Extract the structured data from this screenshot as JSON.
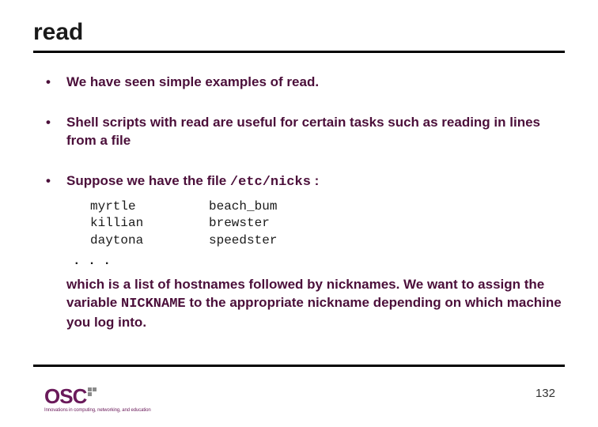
{
  "title": "read",
  "bullets": [
    {
      "text": "We have seen simple examples of read."
    },
    {
      "text": "Shell scripts with read are useful for certain tasks such as reading in lines from a file"
    }
  ],
  "bullet3": {
    "prefix": "Suppose we have the file ",
    "file": "/etc/nicks",
    "suffix": " :",
    "rows": [
      {
        "c1": "myrtle",
        "c2": "beach_bum"
      },
      {
        "c1": "killian",
        "c2": "brewster"
      },
      {
        "c1": "daytona",
        "c2": "speedster"
      }
    ],
    "ellipsis": ". . .",
    "para_a": "which is a list of hostnames followed by nicknames. We want to assign the variable ",
    "para_code": "NICKNAME",
    "para_b": " to the appropriate nickname depending on which machine you log into."
  },
  "logo": {
    "text": "OSC",
    "tagline": "Innovations in computing, networking, and education"
  },
  "page": "132"
}
